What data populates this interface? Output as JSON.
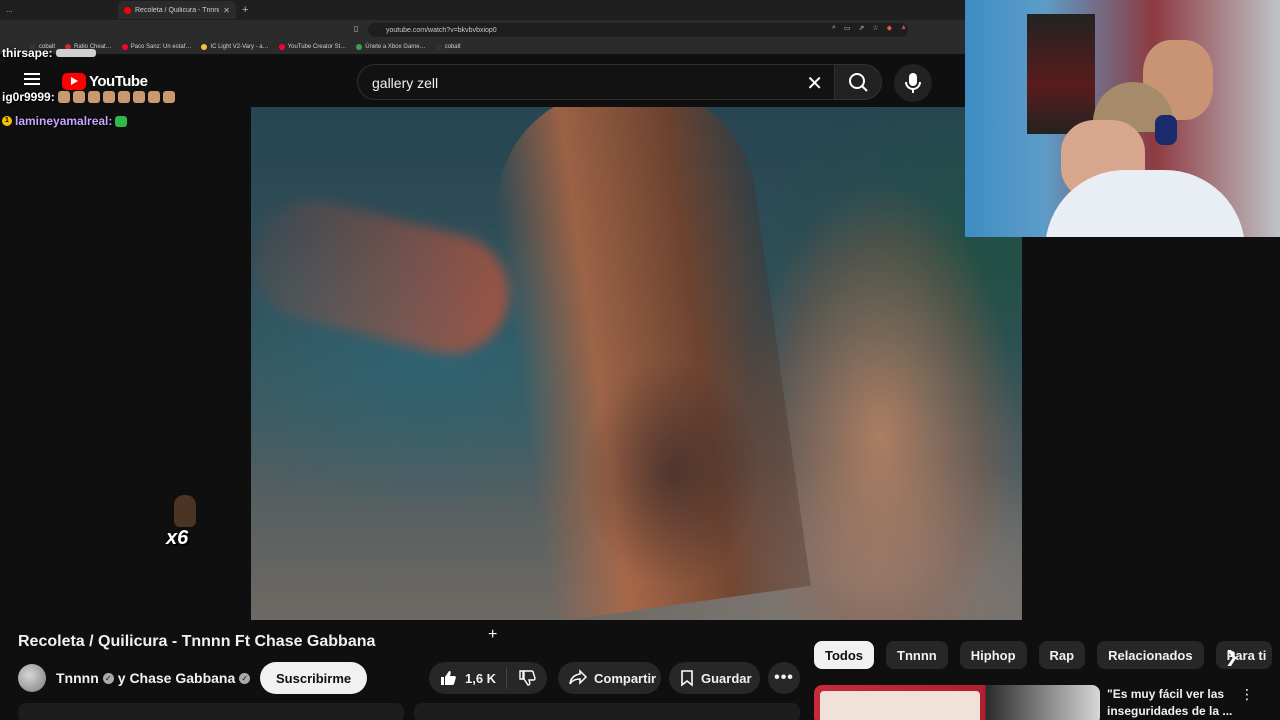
{
  "browser": {
    "tabs": [
      {
        "label": "…"
      },
      {
        "label": "Recoleta / Quilicura - Tnnnn"
      }
    ],
    "new_tab": "+",
    "url": "youtube.com/watch?v=bkvbvbxiop0",
    "bookmarks": [
      {
        "label": "cobalt",
        "color": "#333333"
      },
      {
        "label": "Ratio Cheat…",
        "color": "#cc2b2b"
      },
      {
        "label": "Paco Sanz: Un estaf…",
        "color": "#ff0033"
      },
      {
        "label": "IC Light V2-Vary - a…",
        "color": "#f3c13a"
      },
      {
        "label": "YouTube Creator St…",
        "color": "#ff0033"
      },
      {
        "label": "Únete a Xbox Game…",
        "color": "#3aa34a"
      },
      {
        "label": "cobalt",
        "color": "#333333"
      }
    ]
  },
  "youtube": {
    "logo_text": "YouTube",
    "search_value": "gallery zell"
  },
  "chat": [
    {
      "user": "thirsape:",
      "color": "#ffffff",
      "top": 0
    },
    {
      "user": "ig0r9999:",
      "color": "#ffffff",
      "top": 0
    },
    {
      "user": "lamineyamalreal:",
      "color": "#c9a6ff",
      "top": 0
    }
  ],
  "emote_counter": "x6",
  "video": {
    "title": "Recoleta / Quilicura - Tnnnn Ft Chase Gabbana",
    "channel": "Tnnnn",
    "channel_join": "y Chase Gabbana",
    "subscribe": "Suscribirme",
    "likes": "1,6 K",
    "share": "Compartir",
    "save": "Guardar",
    "more": "•••"
  },
  "chips": [
    "Todos",
    "Tnnnn",
    "Hiphop",
    "Rap",
    "Relacionados",
    "Para ti"
  ],
  "recommended": {
    "title": "\"Es muy fácil ver las inseguridades de la ..."
  }
}
